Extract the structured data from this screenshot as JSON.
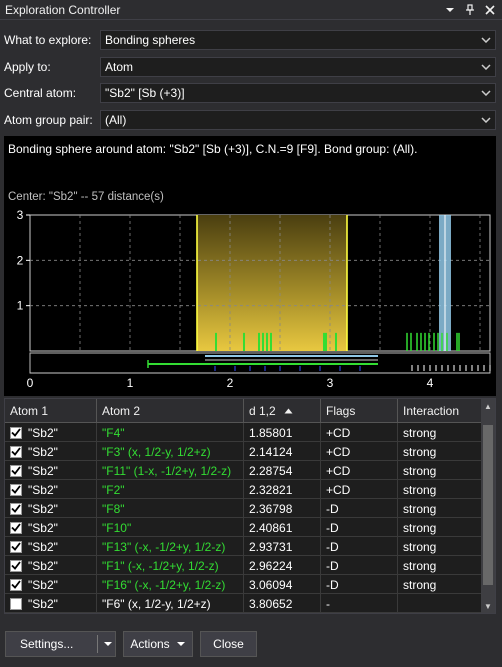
{
  "window": {
    "title": "Exploration Controller",
    "menu_icon": "dropdown-arrow-icon",
    "pin_icon": "pin-icon",
    "close_icon": "close-icon"
  },
  "fields": [
    {
      "label": "What to explore:",
      "value": "Bonding spheres"
    },
    {
      "label": "Apply to:",
      "value": "Atom"
    },
    {
      "label": "Central atom:",
      "value": "\"Sb2\" [Sb (+3)]"
    },
    {
      "label": "Atom group pair:",
      "value": "(All)"
    }
  ],
  "panel": {
    "description": "Bonding sphere around atom: \"Sb2\" [Sb (+3)], C.N.=9 [F9]. Bond group: (All).",
    "center_label": "Center: \"Sb2\" -- 57 distance(s)"
  },
  "chart_data": {
    "type": "bar",
    "title": "",
    "xlabel": "",
    "ylabel": "",
    "xlim": [
      0,
      4.5
    ],
    "ylim": [
      0,
      3
    ],
    "x_ticks": [
      "0",
      "1",
      "2",
      "3",
      "4"
    ],
    "y_ticks": [
      "1",
      "2",
      "3"
    ],
    "grid": true,
    "bonding_sphere_range": [
      1.67,
      3.17
    ],
    "bond_lines": [
      1.86,
      2.14,
      2.29,
      2.33,
      2.37,
      2.41,
      2.94,
      2.96,
      3.06
    ],
    "other_lines": [
      3.77,
      3.81,
      3.87,
      3.91,
      3.95,
      3.99,
      4.04,
      4.08,
      4.12,
      4.17,
      4.27,
      4.29
    ],
    "highlight_line": 4.15,
    "colors": {
      "sphere": "#e8c840",
      "bond": "#33dd33",
      "highlight": "#90c8e8",
      "grid": "#888888",
      "axis": "#ffffff"
    }
  },
  "table": {
    "columns": [
      "Atom 1",
      "Atom 2",
      "d 1,2",
      "Flags",
      "Interaction"
    ],
    "sort_icon": "sort-ascending-icon",
    "rows": [
      {
        "checked": true,
        "atom1": "\"Sb2\"",
        "atom2": "\"F4\"",
        "d": "1.85801",
        "flags": "+CD",
        "interaction": "strong",
        "green": true
      },
      {
        "checked": true,
        "atom1": "\"Sb2\"",
        "atom2": "\"F3\" (x, 1/2-y, 1/2+z)",
        "d": "2.14124",
        "flags": "+CD",
        "interaction": "strong",
        "green": true
      },
      {
        "checked": true,
        "atom1": "\"Sb2\"",
        "atom2": "\"F11\" (1-x, -1/2+y, 1/2-z)",
        "d": "2.28754",
        "flags": "+CD",
        "interaction": "strong",
        "green": true
      },
      {
        "checked": true,
        "atom1": "\"Sb2\"",
        "atom2": "\"F2\"",
        "d": "2.32821",
        "flags": "+CD",
        "interaction": "strong",
        "green": true
      },
      {
        "checked": true,
        "atom1": "\"Sb2\"",
        "atom2": "\"F8\"",
        "d": "2.36798",
        "flags": "-D",
        "interaction": "strong",
        "green": true
      },
      {
        "checked": true,
        "atom1": "\"Sb2\"",
        "atom2": "\"F10\"",
        "d": "2.40861",
        "flags": "-D",
        "interaction": "strong",
        "green": true
      },
      {
        "checked": true,
        "atom1": "\"Sb2\"",
        "atom2": "\"F13\" (-x, -1/2+y, 1/2-z)",
        "d": "2.93731",
        "flags": "-D",
        "interaction": "strong",
        "green": true
      },
      {
        "checked": true,
        "atom1": "\"Sb2\"",
        "atom2": "\"F1\" (-x, -1/2+y, 1/2-z)",
        "d": "2.96224",
        "flags": "-D",
        "interaction": "strong",
        "green": true
      },
      {
        "checked": true,
        "atom1": "\"Sb2\"",
        "atom2": "\"F16\" (-x, -1/2+y, 1/2-z)",
        "d": "3.06094",
        "flags": "-D",
        "interaction": "strong",
        "green": true
      },
      {
        "checked": false,
        "atom1": "\"Sb2\"",
        "atom2": "\"F6\" (x, 1/2-y, 1/2+z)",
        "d": "3.80652",
        "flags": "-",
        "interaction": "",
        "green": false
      }
    ]
  },
  "buttons": {
    "settings": "Settings...",
    "actions": "Actions",
    "close": "Close"
  }
}
